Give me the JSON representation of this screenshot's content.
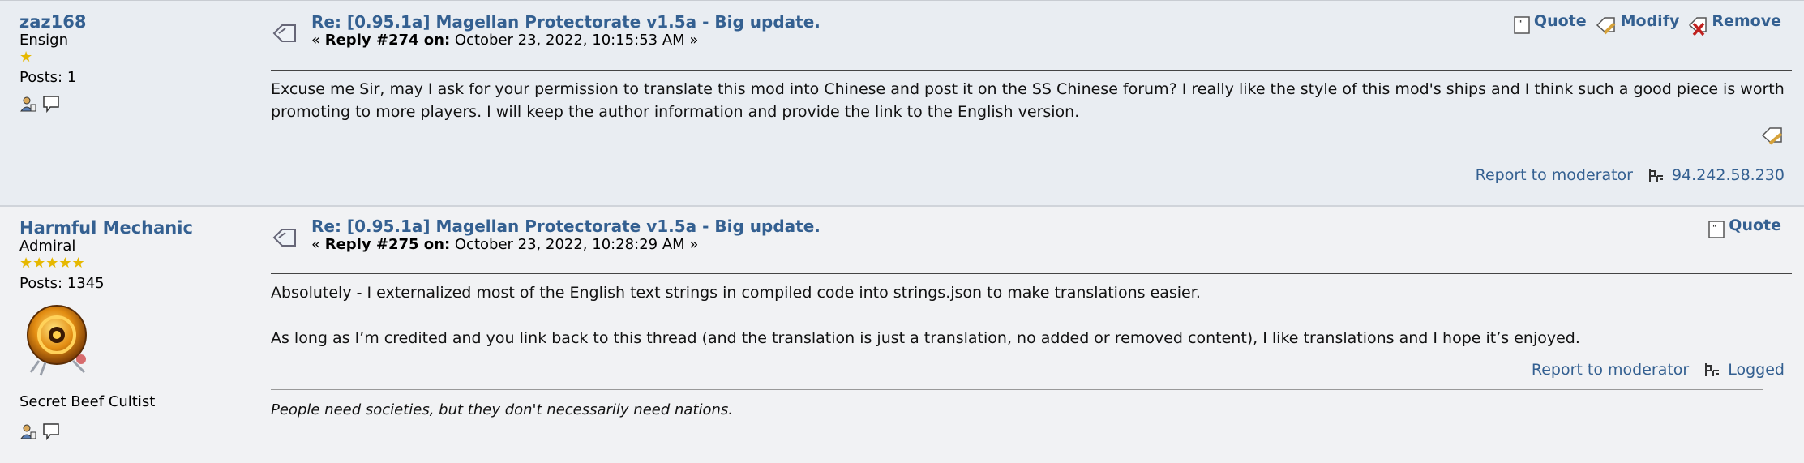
{
  "posts": [
    {
      "author": "zaz168",
      "rank": "Ensign",
      "stars": "★",
      "posts_label": "Posts: 1",
      "subject": "Re: [0.95.1a] Magellan Protectorate v1.5a - Big update.",
      "reply_prefix": "« ",
      "reply_label": "Reply #274 on:",
      "reply_date": " October 23, 2022, 10:15:53 AM »",
      "actions": {
        "quote": "Quote",
        "modify": "Modify",
        "remove": "Remove"
      },
      "body": "Excuse me Sir, may I ask for your permission to translate this mod into Chinese and post it on the SS Chinese forum?  I really like the style of this mod's ships and I think such a good piece is worth promoting to more players. I will keep the author information and provide the link to the English version.",
      "report": "Report to moderator",
      "ip": "94.242.58.230"
    },
    {
      "author": "Harmful Mechanic",
      "rank": "Admiral",
      "stars": "★★★★★",
      "posts_label": "Posts: 1345",
      "custom_title": "Secret Beef Cultist",
      "subject": "Re: [0.95.1a] Magellan Protectorate v1.5a - Big update.",
      "reply_prefix": "« ",
      "reply_label": "Reply #275 on:",
      "reply_date": " October 23, 2022, 10:28:29 AM »",
      "actions": {
        "quote": "Quote"
      },
      "body_p1": "Absolutely - I externalized most of the English text strings in compiled code into strings.json to make translations easier.",
      "body_p2": "As long as I’m credited and you link back to this thread (and the translation is just a translation, no added or removed content), I like translations and I hope it’s enjoyed.",
      "report": "Report to moderator",
      "logged": "Logged",
      "signature": "People need societies, but they don't necessarily need nations."
    }
  ],
  "colors": {
    "link": "#346091",
    "star": "#e6b800"
  }
}
